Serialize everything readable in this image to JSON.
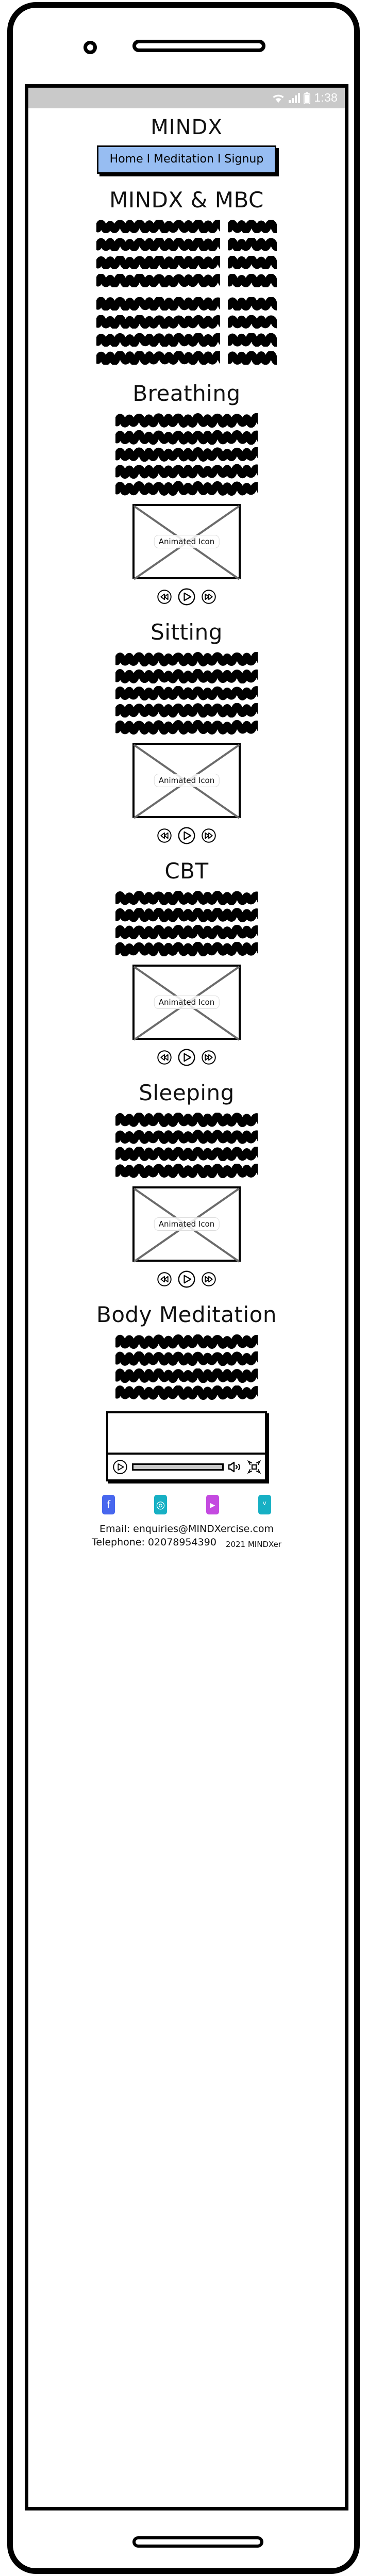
{
  "status_bar": {
    "time": "1:38",
    "wifi_icon": "wifi-icon",
    "signal_icon": "cellular-signal-icon",
    "battery_icon": "battery-icon",
    "background_color": "#c9c9c9"
  },
  "header": {
    "app_title": "MINDX",
    "nav_label": "Home I Meditation I Signup",
    "nav_background_color": "#97bdf2"
  },
  "sections": [
    {
      "id": "mindx-mbc",
      "heading": "MINDX & MBC",
      "paragraphs": [
        {
          "rows": [
            {
              "long": 240,
              "short": 95
            },
            {
              "long": 240,
              "short": 95
            },
            {
              "long": 240,
              "short": 95
            },
            {
              "long": 240,
              "short": 95
            }
          ]
        },
        {
          "rows": [
            {
              "long": 240,
              "short": 95
            },
            {
              "long": 240,
              "short": 95
            },
            {
              "long": 240,
              "short": 95
            },
            {
              "long": 240,
              "short": 95
            }
          ]
        }
      ],
      "has_media": false
    },
    {
      "id": "breathing",
      "heading": "Breathing",
      "paragraphs": [
        {
          "rows": [
            {
              "long": 276,
              "short": 0
            },
            {
              "long": 276,
              "short": 0
            },
            {
              "long": 276,
              "short": 0
            },
            {
              "long": 276,
              "short": 0
            },
            {
              "long": 276,
              "short": 0
            }
          ]
        }
      ],
      "has_media": true,
      "media_label": "Animated Icon",
      "controls": [
        "rewind-button",
        "play-button",
        "fast-forward-button"
      ]
    },
    {
      "id": "sitting",
      "heading": "Sitting",
      "paragraphs": [
        {
          "rows": [
            {
              "long": 276,
              "short": 0
            },
            {
              "long": 276,
              "short": 0
            },
            {
              "long": 276,
              "short": 0
            },
            {
              "long": 276,
              "short": 0
            },
            {
              "long": 276,
              "short": 0
            }
          ]
        }
      ],
      "has_media": true,
      "media_label": "Animated Icon",
      "controls": [
        "rewind-button",
        "play-button",
        "fast-forward-button"
      ]
    },
    {
      "id": "cbt",
      "heading": "CBT",
      "paragraphs": [
        {
          "rows": [
            {
              "long": 276,
              "short": 0
            },
            {
              "long": 276,
              "short": 0
            },
            {
              "long": 276,
              "short": 0
            },
            {
              "long": 276,
              "short": 0
            }
          ]
        }
      ],
      "has_media": true,
      "media_label": "Animated Icon",
      "controls": [
        "rewind-button",
        "play-button",
        "fast-forward-button"
      ]
    },
    {
      "id": "sleeping",
      "heading": "Sleeping",
      "paragraphs": [
        {
          "rows": [
            {
              "long": 276,
              "short": 0
            },
            {
              "long": 276,
              "short": 0
            },
            {
              "long": 276,
              "short": 0
            },
            {
              "long": 276,
              "short": 0
            }
          ]
        }
      ],
      "has_media": true,
      "media_label": "Animated Icon",
      "controls": [
        "rewind-button",
        "play-button",
        "fast-forward-button"
      ]
    },
    {
      "id": "body-meditation",
      "heading": "Body Meditation",
      "paragraphs": [
        {
          "rows": [
            {
              "long": 276,
              "short": 0
            },
            {
              "long": 276,
              "short": 0
            },
            {
              "long": 276,
              "short": 0
            },
            {
              "long": 276,
              "short": 0
            }
          ]
        }
      ],
      "has_media": false,
      "has_video": true
    }
  ],
  "video_player": {
    "play_icon": "play-icon",
    "progress_value": 100,
    "volume_icon": "volume-icon",
    "fullscreen_icon": "fullscreen-icon",
    "progress_color": "#c9c9c9"
  },
  "footer": {
    "social": [
      {
        "name": "facebook-icon",
        "color": "#4867ee",
        "glyph": "f"
      },
      {
        "name": "instagram-icon",
        "color": "#17b0c4",
        "glyph": "◎"
      },
      {
        "name": "video-play-icon",
        "color": "#c44ae0",
        "glyph": "▸"
      },
      {
        "name": "twitter-icon",
        "color": "#17b0c4",
        "glyph": "ᵛ"
      }
    ],
    "email_line": "Email: enquiries@MINDXercise.com",
    "telephone_line": "Telephone: 02078954390",
    "copyright": "2021 MINDXer"
  }
}
